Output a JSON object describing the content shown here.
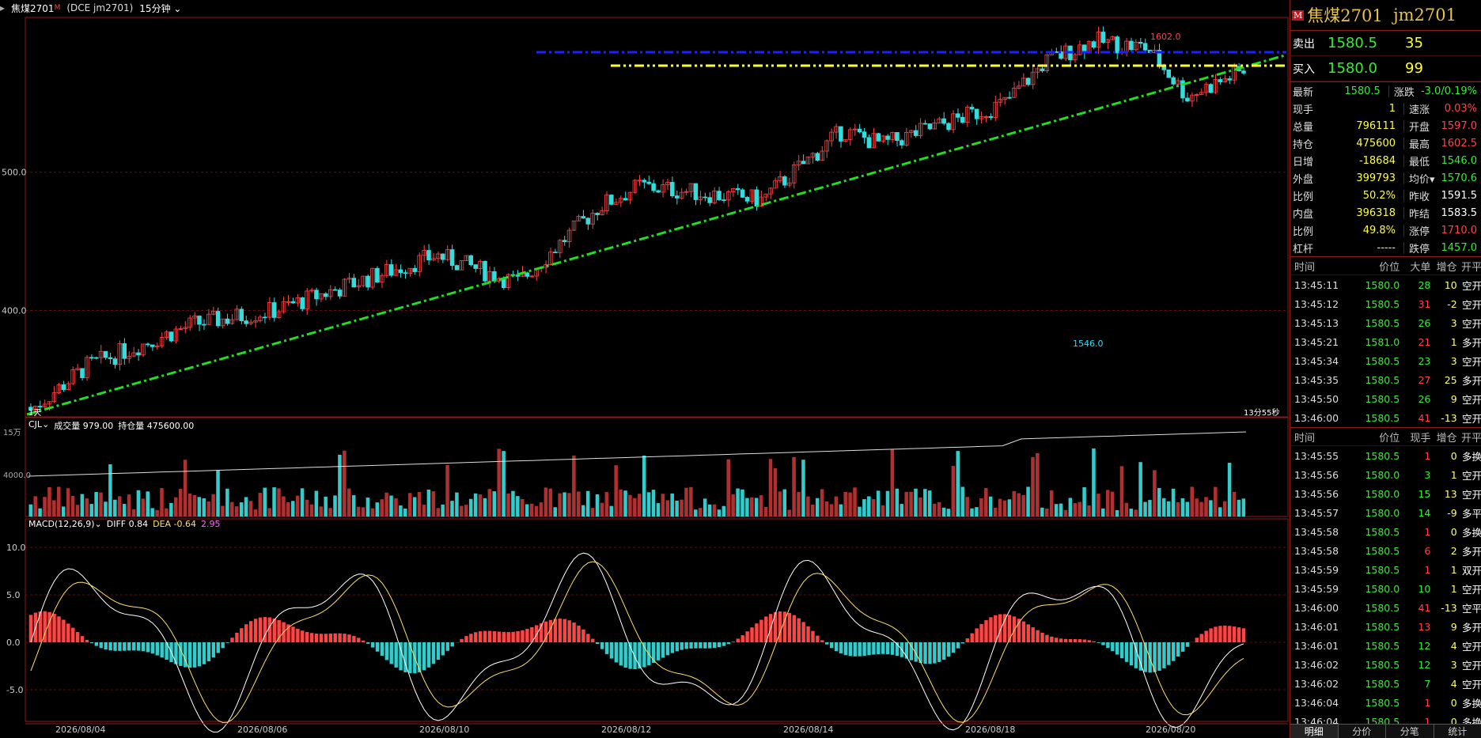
{
  "header": {
    "symbol": "焦煤2701",
    "flag": "M",
    "sub": "(DCE jm2701)",
    "period": "15分钟"
  },
  "price_axis": {
    "ticks": [
      {
        "label": "500.0",
        "value": 1500
      },
      {
        "label": "400.0",
        "value": 1400
      }
    ],
    "range": [
      1323,
      1612
    ]
  },
  "main_annotations": {
    "high_label": "1602.0",
    "low_label": "1546.0",
    "bottom_left": "1天",
    "countdown": "13分55秒"
  },
  "date_axis": [
    "2026/08/04",
    "2026/08/06",
    "2026/08/10",
    "2026/08/12",
    "2026/08/14",
    "2026/08/18",
    "2026/08/20"
  ],
  "volume_panel": {
    "indicator": "CJL",
    "vol_label": "成交量 979.00",
    "oi_label": "持仓量 475600.00",
    "y_top": "15万",
    "y_mid": "4000.0"
  },
  "macd_panel": {
    "title": "MACD(12,26,9)",
    "diff": "DIFF 0.84",
    "dea": "DEA -0.64",
    "macd": "2.95",
    "ticks": [
      "10.0",
      "5.0",
      "0.0",
      "-5.0"
    ]
  },
  "right_panel": {
    "flag": "M",
    "title": "焦煤2701",
    "code": "jm2701",
    "ask": {
      "label": "卖出",
      "price": "1580.5",
      "qty": "35"
    },
    "bid": {
      "label": "买入",
      "price": "1580.0",
      "qty": "99"
    },
    "stats": [
      {
        "k": "最新",
        "v": "1580.5",
        "vc": "#33ee33",
        "k2": "涨跌",
        "v2": "-3.0/0.19%",
        "v2c": "#33ee33"
      },
      {
        "k": "现手",
        "v": "1",
        "vc": "#ffff33",
        "k2": "速涨",
        "v2": "0.03%",
        "v2c": "#ff4444"
      },
      {
        "k": "总量",
        "v": "796111",
        "vc": "#ffff33",
        "k2": "开盘",
        "v2": "1597.0",
        "v2c": "#ff4444"
      },
      {
        "k": "持仓",
        "v": "475600",
        "vc": "#ffff33",
        "k2": "最高",
        "v2": "1602.5",
        "v2c": "#ff4444"
      },
      {
        "k": "日增",
        "v": "-18684",
        "vc": "#ffff33",
        "k2": "最低",
        "v2": "1546.0",
        "v2c": "#33ee33"
      },
      {
        "k": "外盘",
        "v": "399793",
        "vc": "#ffff33",
        "k2": "均价▾",
        "v2": "1570.6",
        "v2c": "#33ee33"
      },
      {
        "k": "比例",
        "v": "50.2%",
        "vc": "#ffff33",
        "k2": "昨收",
        "v2": "1591.5",
        "v2c": "#ffffff"
      },
      {
        "k": "内盘",
        "v": "396318",
        "vc": "#ffff33",
        "k2": "昨结",
        "v2": "1583.5",
        "v2c": "#ffffff"
      },
      {
        "k": "比例",
        "v": "49.8%",
        "vc": "#ffff33",
        "k2": "涨停",
        "v2": "1710.0",
        "v2c": "#ff4444"
      },
      {
        "k": "杠杆",
        "v": "-----",
        "vc": "#ffff33",
        "k2": "跌停",
        "v2": "1457.0",
        "v2c": "#33ee33"
      }
    ],
    "table1_header": [
      "时间",
      "价位",
      "大单",
      "增仓",
      "开平"
    ],
    "table1": [
      [
        "13:45:11",
        "1580.0",
        "28",
        "10",
        "空开",
        "g"
      ],
      [
        "13:45:12",
        "1580.5",
        "31",
        "-2",
        "空开",
        "r"
      ],
      [
        "13:45:13",
        "1580.5",
        "26",
        "3",
        "空开",
        "g"
      ],
      [
        "13:45:21",
        "1581.0",
        "21",
        "1",
        "多开",
        "r"
      ],
      [
        "13:45:34",
        "1580.5",
        "23",
        "3",
        "空开",
        "g"
      ],
      [
        "13:45:35",
        "1580.5",
        "27",
        "25",
        "多开",
        "r"
      ],
      [
        "13:45:50",
        "1580.5",
        "26",
        "9",
        "空开",
        "g"
      ],
      [
        "13:46:00",
        "1580.5",
        "41",
        "-13",
        "空开",
        "r"
      ]
    ],
    "table2_header": [
      "时间",
      "价位",
      "现手",
      "增仓",
      "开平"
    ],
    "table2": [
      [
        "13:45:55",
        "1580.5",
        "1",
        "0",
        "多换",
        "r"
      ],
      [
        "13:45:56",
        "1580.0",
        "3",
        "1",
        "空开",
        "g"
      ],
      [
        "13:45:56",
        "1580.0",
        "15",
        "13",
        "空开",
        "g"
      ],
      [
        "13:45:57",
        "1580.0",
        "14",
        "-9",
        "多平",
        "g"
      ],
      [
        "13:45:58",
        "1580.5",
        "1",
        "0",
        "多换",
        "r"
      ],
      [
        "13:45:58",
        "1580.5",
        "6",
        "2",
        "多开",
        "r"
      ],
      [
        "13:45:59",
        "1580.5",
        "1",
        "1",
        "双开",
        "r"
      ],
      [
        "13:45:59",
        "1580.0",
        "10",
        "1",
        "空开",
        "g"
      ],
      [
        "13:46:00",
        "1580.5",
        "41",
        "-13",
        "空平",
        "r"
      ],
      [
        "13:46:01",
        "1580.5",
        "13",
        "9",
        "多开",
        "r"
      ],
      [
        "13:46:01",
        "1580.5",
        "12",
        "4",
        "空开",
        "g"
      ],
      [
        "13:46:02",
        "1580.5",
        "12",
        "3",
        "空开",
        "g"
      ],
      [
        "13:46:02",
        "1580.5",
        "7",
        "4",
        "空开",
        "g"
      ],
      [
        "13:46:04",
        "1580.5",
        "1",
        "0",
        "多换",
        "r"
      ],
      [
        "13:46:04",
        "1580.5",
        "1",
        "0",
        "多换",
        "r"
      ]
    ],
    "tabs": [
      "明细",
      "分价",
      "分笔",
      "统计"
    ]
  },
  "colors": {
    "up": "#ff4444",
    "down": "#33dddd",
    "trend": "#22dd22",
    "resist_yellow": "#ffff33",
    "resist_blue": "#1a22ff",
    "frame": "#8b1a1a"
  }
}
